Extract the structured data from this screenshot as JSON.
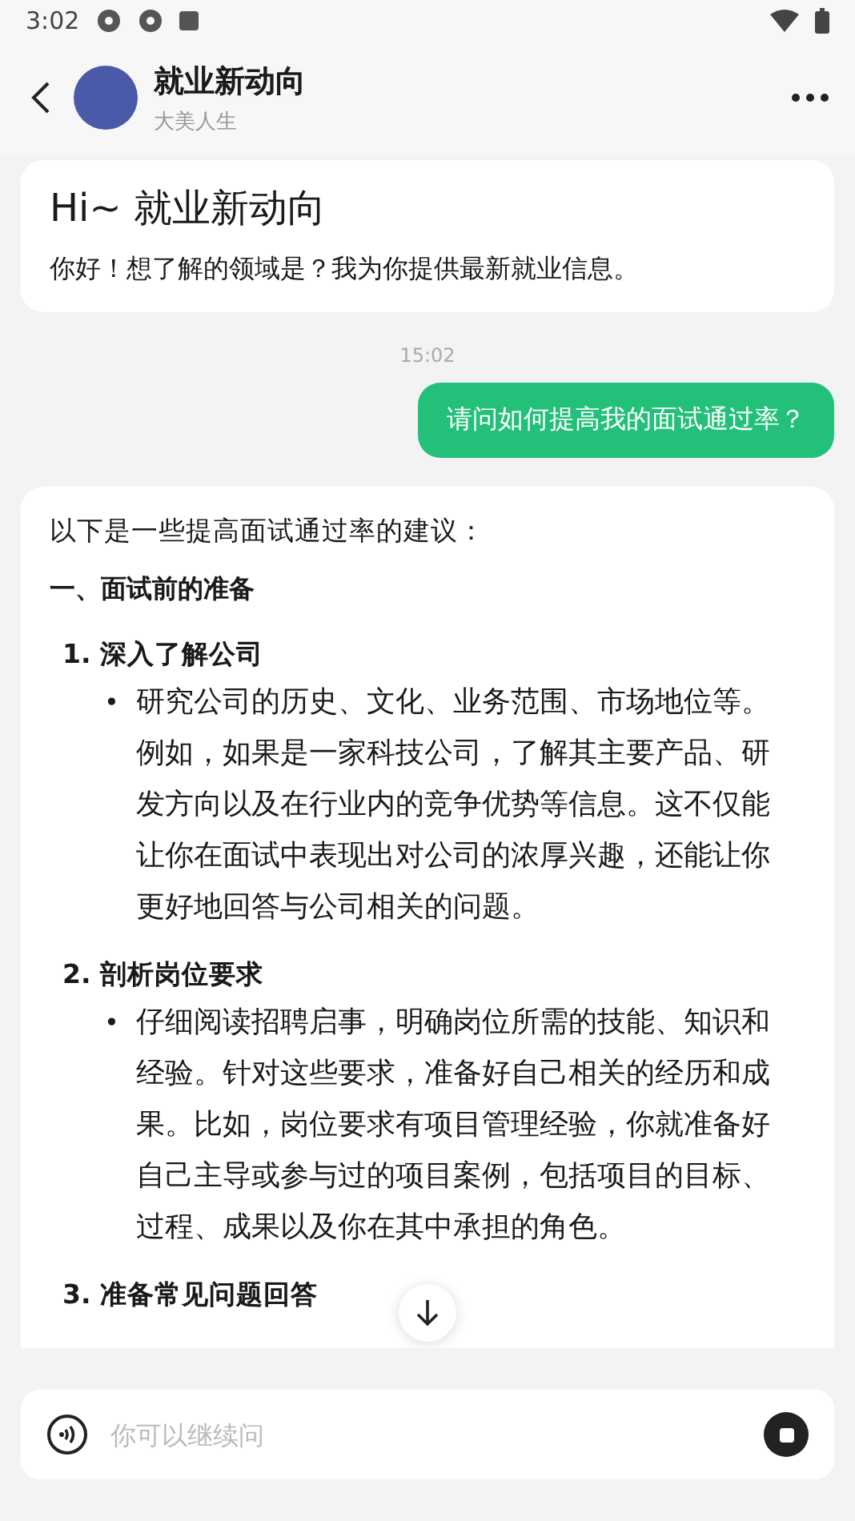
{
  "status_bar": {
    "time": "3:02"
  },
  "header": {
    "title": "就业新动向",
    "subtitle": "大美人生"
  },
  "greeting": {
    "title": "Hi~ 就业新动向",
    "text": "你好！想了解的领域是？我为你提供最新就业信息。"
  },
  "timestamp": "15:02",
  "user_message": "请问如何提高我的面试通过率？",
  "answer": {
    "intro": "以下是一些提高面试通过率的建议：",
    "section": "一、面试前的准备",
    "items": [
      {
        "title": "1. 深入了解公司",
        "marker": "•",
        "bullets": [
          "研究公司的历史、文化、业务范围、市场地位等。例如，如果是一家科技公司，了解其主要产品、研发方向以及在行业内的竞争优势等信息。这不仅能让你在面试中表现出对公司的浓厚兴趣，还能让你更好地回答与公司相关的问题。"
        ]
      },
      {
        "title": "2. 剖析岗位要求",
        "marker": "•",
        "bullets": [
          "仔细阅读招聘启事，明确岗位所需的技能、知识和经验。针对这些要求，准备好自己相关的经历和成果。比如，岗位要求有项目管理经验，你就准备好自己主导或参与过的项目案例，包括项目的目标、过程、成果以及你在其中承担的角色。"
        ]
      },
      {
        "title": "3. 准备常见问题回答"
      }
    ]
  },
  "input": {
    "placeholder": "你可以继续问"
  }
}
